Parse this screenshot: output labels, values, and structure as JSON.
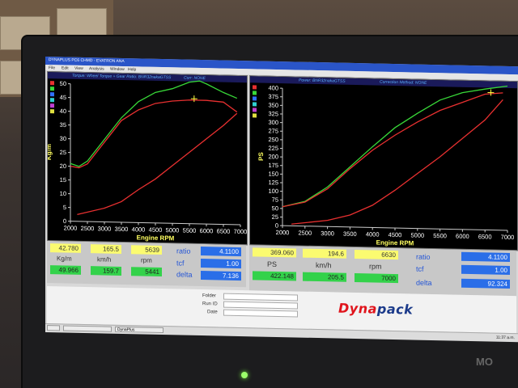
{
  "app": {
    "title": "DYNAPLUS PC6 CHMD - EVATRON ANA",
    "menu": [
      "File",
      "Edit",
      "View",
      "Analysis",
      "Window",
      "Help"
    ]
  },
  "left_panel": {
    "header": {
      "legend": "Torque: Wheel Torque + Gear Ratio: BNR32nakaGTSS",
      "correction": "Corr: NONE"
    },
    "swatch_colors": [
      "#e83030",
      "#38d838",
      "#3070ff",
      "#30d0d0",
      "#c040d0",
      "#e0e040"
    ]
  },
  "right_panel": {
    "header": {
      "legend": "Power: BNR32nakaGTSS",
      "correction": "Correction Method: NONE"
    },
    "swatch_colors": [
      "#e83030",
      "#38d838",
      "#3070ff",
      "#30d0d0",
      "#c040d0",
      "#e0e040"
    ]
  },
  "chart_data": [
    {
      "type": "line",
      "title": "",
      "xlabel": "Engine RPM",
      "ylabel": "Kg/m",
      "xlim": [
        2000,
        7000
      ],
      "ylim": [
        0,
        50
      ],
      "xticks": [
        2000,
        2500,
        3000,
        3500,
        4000,
        4500,
        5000,
        5500,
        6000,
        6500,
        7000
      ],
      "yticks": [
        0,
        5,
        10,
        15,
        20,
        25,
        30,
        35,
        40,
        45,
        50
      ],
      "series": [
        {
          "name": "",
          "color": "#38d838",
          "x": [
            2000,
            2250,
            2500,
            3000,
            3500,
            4000,
            4500,
            5000,
            5500,
            5800,
            6000,
            6500,
            6900
          ],
          "values": [
            21,
            20,
            22,
            30,
            38,
            44,
            47.5,
            49,
            51.5,
            52,
            51,
            48,
            46
          ]
        },
        {
          "name": "",
          "color": "#e83030",
          "x": [
            2000,
            2250,
            2500,
            3000,
            3500,
            4000,
            4500,
            5000,
            5500,
            5639,
            6000,
            6500,
            6900
          ],
          "values": [
            20,
            19.5,
            21,
            29,
            37,
            41,
            43.5,
            44.5,
            45,
            45,
            45,
            44.5,
            41
          ]
        },
        {
          "name": "",
          "color": "#e83030",
          "x": [
            2200,
            3000,
            3500,
            4000,
            4500,
            5000,
            5500,
            6000,
            6500,
            6900
          ],
          "values": [
            2.5,
            5,
            7.5,
            12,
            16,
            21,
            26,
            31,
            36,
            40.5
          ]
        }
      ],
      "cursor": {
        "x": 5639,
        "y": 45.5
      }
    },
    {
      "type": "line",
      "title": "",
      "xlabel": "Engine RPM",
      "ylabel": "PS",
      "xlim": [
        2000,
        7000
      ],
      "ylim": [
        0,
        400
      ],
      "xticks": [
        2000,
        2500,
        3000,
        3500,
        4000,
        4500,
        5000,
        5500,
        6000,
        6500,
        7000
      ],
      "yticks": [
        0,
        25,
        50,
        75,
        100,
        125,
        150,
        175,
        200,
        225,
        250,
        275,
        300,
        325,
        350,
        375,
        400
      ],
      "series": [
        {
          "name": "",
          "color": "#38d838",
          "x": [
            2000,
            2500,
            3000,
            3500,
            4000,
            4500,
            5000,
            5500,
            6000,
            6500,
            7000
          ],
          "values": [
            55,
            72,
            115,
            175,
            235,
            292,
            335,
            375,
            398,
            410,
            420
          ]
        },
        {
          "name": "",
          "color": "#e83030",
          "x": [
            2000,
            2500,
            3000,
            3500,
            4000,
            4500,
            5000,
            5500,
            6000,
            6500,
            6900
          ],
          "values": [
            55,
            70,
            110,
            170,
            225,
            270,
            310,
            345,
            370,
            395,
            400
          ]
        },
        {
          "name": "",
          "color": "#e83030",
          "x": [
            2200,
            3000,
            3500,
            4000,
            4500,
            5000,
            5500,
            6000,
            6500,
            6900
          ],
          "values": [
            5,
            18,
            35,
            65,
            110,
            160,
            210,
            265,
            320,
            380
          ]
        }
      ],
      "cursor": {
        "x": 6630,
        "y": 400
      }
    }
  ],
  "left_readouts": {
    "row1": [
      "42.780",
      "165.5",
      "5639"
    ],
    "labels": [
      "Kg/m",
      "km/h",
      "rpm"
    ],
    "row2": [
      "49.966",
      "159.7",
      "5441"
    ],
    "ratio_label": "ratio",
    "ratio": "4.1100",
    "tcf_label": "tcf",
    "tcf": "1.00",
    "delta_label": "delta",
    "delta": "7.136"
  },
  "right_readouts": {
    "row1": [
      "369.060",
      "194.6",
      "6630"
    ],
    "labels": [
      "PS",
      "km/h",
      "rpm"
    ],
    "row2": [
      "422.148",
      "205.5",
      "7000"
    ],
    "ratio_label": "ratio",
    "ratio": "4.1100",
    "tcf_label": "tcf",
    "tcf": "1.00",
    "delta_label": "delta",
    "delta": "92.324"
  },
  "info": {
    "folder_label": "Folder",
    "run_id_label": "Run ID",
    "date_label": "Date"
  },
  "logo": {
    "part1": "Dyna",
    "part2": "pack"
  },
  "taskbar": {
    "tasks": [
      "",
      "",
      "DynaPlus"
    ],
    "clock": "11:37 a.m."
  },
  "monitor_brand": "MO"
}
